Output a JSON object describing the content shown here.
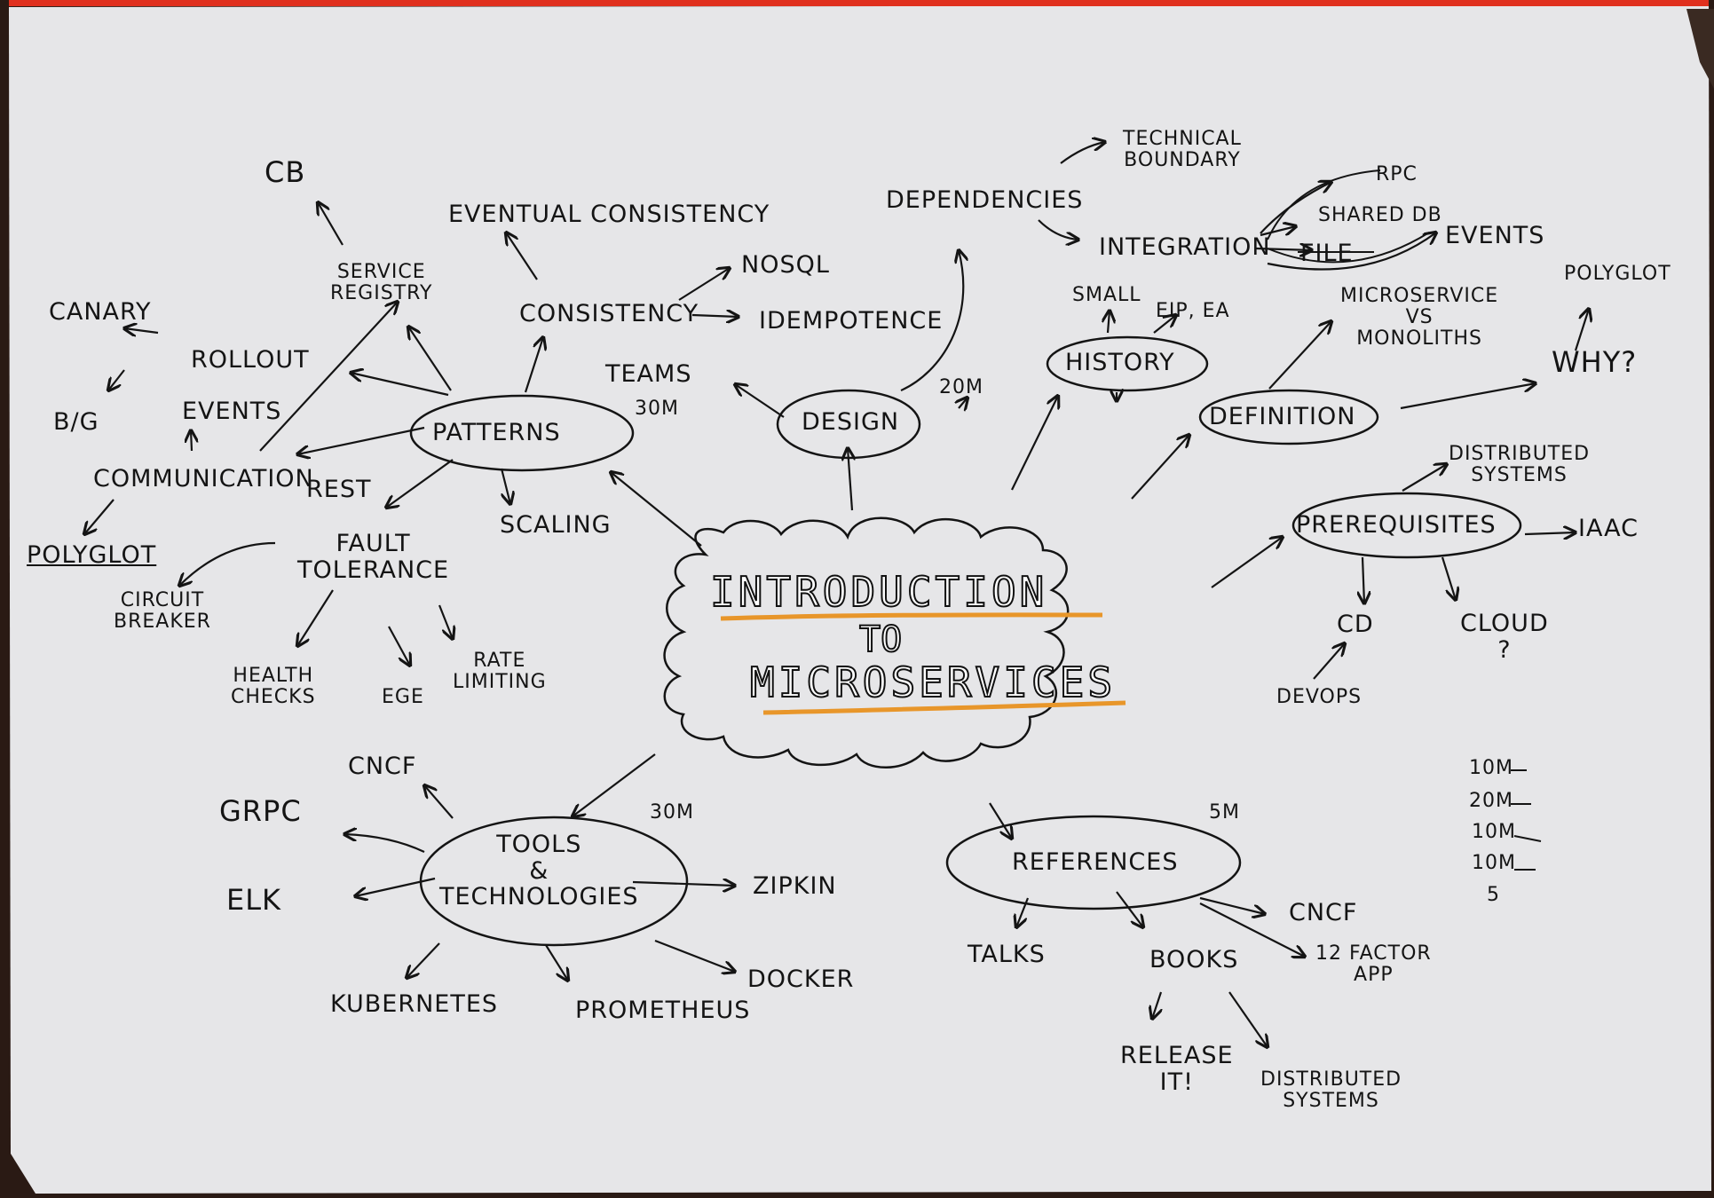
{
  "center": {
    "line1": "INTRODUCTION",
    "line2": "TO",
    "line3": "MICROSERVICES"
  },
  "patterns": {
    "title": "PATTERNS",
    "cb": "CB",
    "service_registry": "SERVICE\nREGISTRY",
    "eventual_consistency": "EVENTUAL CONSISTENCY",
    "consistency": "CONSISTENCY",
    "nosql": "NOSQL",
    "idempotence": "IDEMPOTENCE",
    "canary": "CANARY",
    "rollout": "ROLLOUT",
    "bg": "B/G",
    "events": "EVENTS",
    "communication": "COMMUNICATION",
    "rest": "REST",
    "polyglot": "POLYGLOT",
    "scaling": "SCALING",
    "fault_tolerance": "FAULT\nTOLERANCE",
    "circuit_breaker": "CIRCUIT\nBREAKER",
    "health_checks": "HEALTH\nCHECKS",
    "rate_limiting": "RATE\nLIMITING",
    "ege": "EGE",
    "time": "30m"
  },
  "design": {
    "title": "DESIGN",
    "teams": "TEAMS",
    "time": "20m",
    "dependencies": "DEPENDENCIES",
    "technical_boundary": "TECHNICAL\nBOUNDARY",
    "integration": "INTEGRATION",
    "rpc": "RPC",
    "shared_db": "SHARED DB",
    "file": "FILE",
    "events": "EVENTS"
  },
  "history": {
    "title": "HISTORY",
    "small": "SMALL",
    "eip_ea": "EIP, EA"
  },
  "definition": {
    "title": "DEFINITION",
    "ms_vs_monoliths": "MICROSERVICE\nVS\nMONOLITHS",
    "why": "WHY?",
    "polyglot": "POLYGLOT"
  },
  "prerequisites": {
    "title": "PREREQUISITES",
    "distributed_systems": "DISTRIBUTED\nSYSTEMS",
    "iaac": "IAAC",
    "cd": "CD",
    "devops": "DEVOPS",
    "cloud": "CLOUD\n?"
  },
  "tools": {
    "title": "TOOLS\n&\nTECHNOLOGIES",
    "time": "30m",
    "cncf": "CNCF",
    "grpc": "GRPC",
    "elk": "ELK",
    "zipkin": "ZIPKIN",
    "docker": "DOCKER",
    "kubernetes": "KUBERNETES",
    "prometheus": "PROMETHEUS"
  },
  "references": {
    "title": "REFERENCES",
    "time": "5m",
    "talks": "TALKS",
    "books": "BOOKS",
    "cncf": "CNCF",
    "twelve_factor": "12 FACTOR\nAPP",
    "release_it": "RELEASE\nIT!",
    "distributed_systems": "DISTRIBUTED\nSYSTEMS"
  },
  "timing_notes": [
    "10m",
    "20m",
    "10m",
    "10m",
    "5"
  ],
  "colors": {
    "paper": "#e6e6e8",
    "ink": "#141414",
    "title_underline": "#e8962a",
    "top_edge": "#e0301e",
    "backdrop": "#2a1a14"
  }
}
